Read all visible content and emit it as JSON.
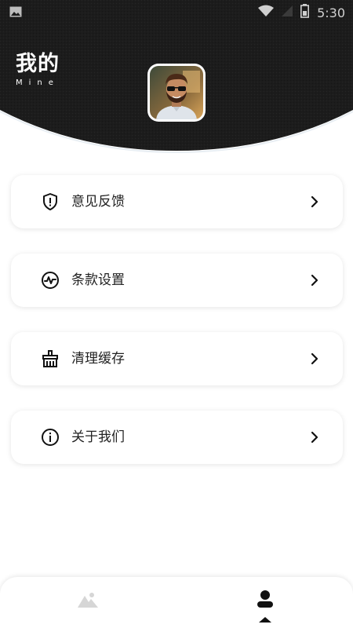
{
  "status_bar": {
    "time": "5:30",
    "left_icon": "image-notification-icon",
    "right_icons": [
      "wifi-icon",
      "signal-icon",
      "battery-icon"
    ]
  },
  "header": {
    "title": "我的",
    "subtitle": "Mine",
    "background_color": "#1c1c1c",
    "avatar": "profile-avatar"
  },
  "menu": [
    {
      "label": "意见反馈",
      "icon": "shield-alert-icon"
    },
    {
      "label": "条款设置",
      "icon": "activity-pulse-icon"
    },
    {
      "label": "清理缓存",
      "icon": "broom-clean-icon"
    },
    {
      "label": "关于我们",
      "icon": "info-icon"
    }
  ],
  "tab_bar": {
    "tabs": [
      {
        "name": "gallery",
        "icon": "mountain-image-icon",
        "active": false
      },
      {
        "name": "mine",
        "icon": "person-icon",
        "active": true
      }
    ],
    "active_color": "#111111",
    "inactive_color": "#cfcfcf"
  }
}
